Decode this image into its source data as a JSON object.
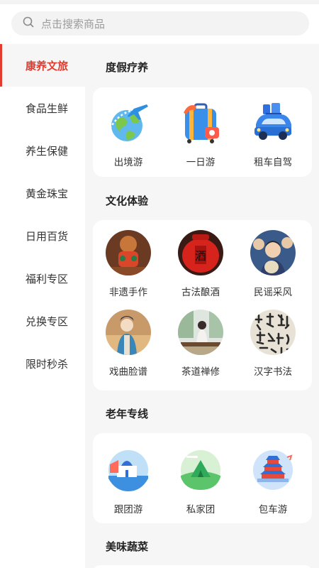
{
  "search": {
    "placeholder": "点击搜索商品",
    "icon": "search-icon"
  },
  "sidebar": {
    "active_color": "#e23b2f",
    "items": [
      {
        "label": "康养文旅",
        "active": true
      },
      {
        "label": "食品生鲜"
      },
      {
        "label": "养生保健"
      },
      {
        "label": "黄金珠宝"
      },
      {
        "label": "日用百货"
      },
      {
        "label": "福利专区"
      },
      {
        "label": "兑换专区"
      },
      {
        "label": "限时秒杀"
      }
    ]
  },
  "sections": [
    {
      "title": "度假疗养",
      "items": [
        {
          "label": "出境游",
          "icon": "airplane-globe-icon"
        },
        {
          "label": "一日游",
          "icon": "suitcase-icon"
        },
        {
          "label": "租车自驾",
          "icon": "car-luggage-icon"
        }
      ]
    },
    {
      "title": "文化体验",
      "items": [
        {
          "label": "非遗手作",
          "icon": "craft-photo"
        },
        {
          "label": "古法酿酒",
          "icon": "wine-jar-photo"
        },
        {
          "label": "民谣采风",
          "icon": "folk-music-photo"
        },
        {
          "label": "戏曲脸谱",
          "icon": "opera-photo"
        },
        {
          "label": "茶道禅修",
          "icon": "tea-ceremony-photo"
        },
        {
          "label": "汉字书法",
          "icon": "calligraphy-photo"
        }
      ]
    },
    {
      "title": "老年专线",
      "items": [
        {
          "label": "跟团游",
          "icon": "santorini-icon"
        },
        {
          "label": "私家团",
          "icon": "tent-icon"
        },
        {
          "label": "包车游",
          "icon": "temple-of-heaven-icon"
        }
      ]
    },
    {
      "title": "美味蔬菜"
    }
  ]
}
